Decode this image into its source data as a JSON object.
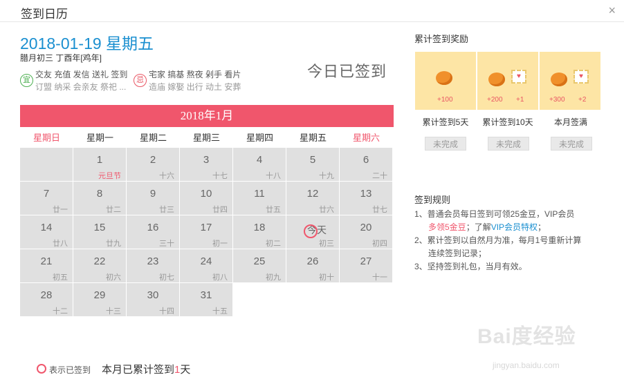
{
  "window": {
    "title": "签到日历",
    "close_label": "×"
  },
  "today": {
    "date": "2018-01-19 星期五",
    "lunar": "腊月初三 丁酉年[鸡年]",
    "yi_badge": "宜",
    "yi_line1": "交友 充值 发信 送礼 签到",
    "yi_line2": "订盟 纳采 会亲友 祭祀 ...",
    "ji_badge": "忌",
    "ji_line1": "宅家 搞基 熬夜 剁手 看片",
    "ji_line2": "造庙 嫁娶 出行 动土 安葬",
    "status": "今日已签到"
  },
  "calendar": {
    "month_title": "2018年1月",
    "weekdays": [
      "星期日",
      "星期一",
      "星期二",
      "星期三",
      "星期四",
      "星期五",
      "星期六"
    ],
    "days": [
      {
        "d": "1",
        "l": "元旦节",
        "fest": true
      },
      {
        "d": "2",
        "l": "十六"
      },
      {
        "d": "3",
        "l": "十七"
      },
      {
        "d": "4",
        "l": "十八"
      },
      {
        "d": "5",
        "l": "十九"
      },
      {
        "d": "6",
        "l": "二十"
      },
      {
        "d": "7",
        "l": "廿一"
      },
      {
        "d": "8",
        "l": "廿二"
      },
      {
        "d": "9",
        "l": "廿三"
      },
      {
        "d": "10",
        "l": "廿四"
      },
      {
        "d": "11",
        "l": "廿五"
      },
      {
        "d": "12",
        "l": "廿六"
      },
      {
        "d": "13",
        "l": "廿七"
      },
      {
        "d": "14",
        "l": "廿八"
      },
      {
        "d": "15",
        "l": "廿九"
      },
      {
        "d": "16",
        "l": "三十"
      },
      {
        "d": "17",
        "l": "初一"
      },
      {
        "d": "18",
        "l": "初二"
      },
      {
        "d": "今天",
        "l": "初三",
        "today": true,
        "signed": true
      },
      {
        "d": "20",
        "l": "初四"
      },
      {
        "d": "21",
        "l": "初五"
      },
      {
        "d": "22",
        "l": "初六"
      },
      {
        "d": "23",
        "l": "初七"
      },
      {
        "d": "24",
        "l": "初八"
      },
      {
        "d": "25",
        "l": "初九"
      },
      {
        "d": "26",
        "l": "初十"
      },
      {
        "d": "27",
        "l": "十一"
      },
      {
        "d": "28",
        "l": "十二"
      },
      {
        "d": "29",
        "l": "十三"
      },
      {
        "d": "30",
        "l": "十四"
      },
      {
        "d": "31",
        "l": "十五"
      }
    ],
    "legend": "表示已签到",
    "month_count_prefix": "本月已累计签到",
    "month_count_value": "1",
    "month_count_suffix": "天"
  },
  "rewards": {
    "title": "累计签到奖励",
    "items": [
      {
        "amount": "+100",
        "card": "",
        "label": "累计签到5天",
        "status": "未完成"
      },
      {
        "amount": "+200",
        "card": "+1",
        "label": "累计签到10天",
        "status": "未完成"
      },
      {
        "amount": "+300",
        "card": "+2",
        "label": "本月签满",
        "status": "未完成"
      }
    ],
    "card_glyph": "♥"
  },
  "rules": {
    "title": "签到规则",
    "r1_a": "1、普通会员每日签到可领25金豆，VIP会员",
    "r1_b": "多领5金豆",
    "r1_c": "；了解",
    "r1_link": "VIP会员特权",
    "r1_d": "；",
    "r2_a": "2、累计签到以自然月为准，每月1号重新计算",
    "r2_b": "连续签到记录；",
    "r3": "3、坚持签到礼包，当月有效。"
  },
  "watermark": {
    "brand": "Bai度经验",
    "url": "jingyan.baidu.com"
  },
  "colors": {
    "accent": "#f0566c",
    "link": "#1a8fd0",
    "reward_bg": "#fde5a5"
  }
}
